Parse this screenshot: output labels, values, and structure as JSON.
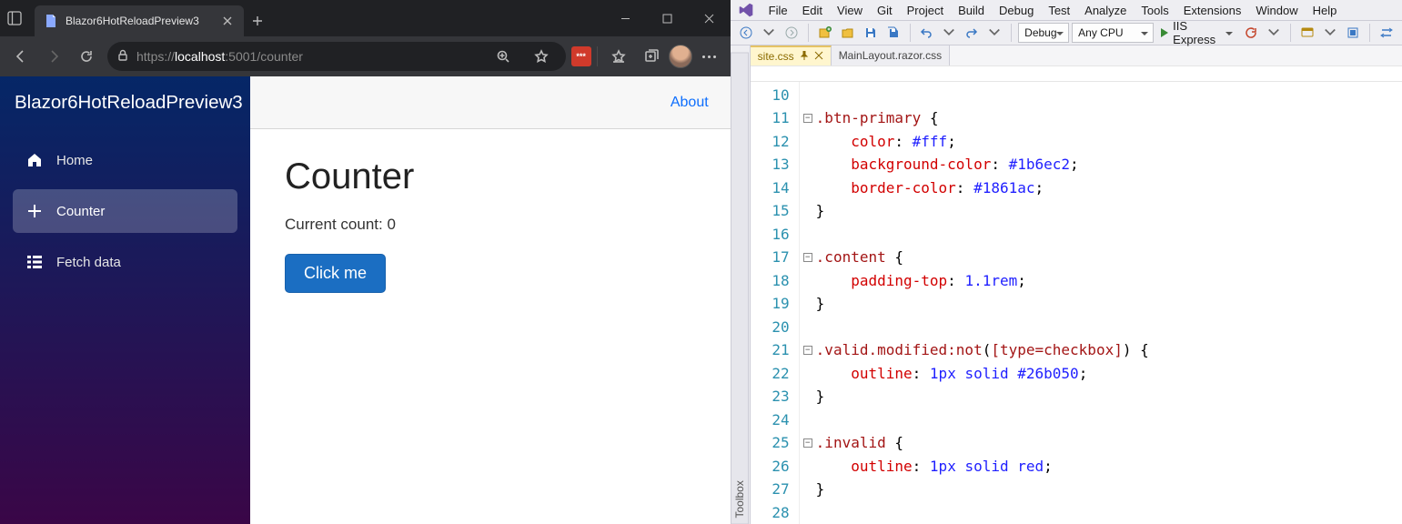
{
  "browser": {
    "tab_title": "Blazor6HotReloadPreview3",
    "url_scheme": "https://",
    "url_host": "localhost",
    "url_port_path": ":5001/counter"
  },
  "app": {
    "brand": "Blazor6HotReloadPreview3",
    "nav": {
      "home": "Home",
      "counter": "Counter",
      "fetch": "Fetch data"
    },
    "about": "About",
    "page_title": "Counter",
    "count_label": "Current count: ",
    "count_value": "0",
    "button": "Click me"
  },
  "vs": {
    "menu": [
      "File",
      "Edit",
      "View",
      "Git",
      "Project",
      "Build",
      "Debug",
      "Test",
      "Analyze",
      "Tools",
      "Extensions",
      "Window",
      "Help"
    ],
    "config": "Debug",
    "platform": "Any CPU",
    "run": "IIS Express",
    "toolbox": "Toolbox",
    "tabs": {
      "active": "site.css",
      "inactive": "MainLayout.razor.css"
    },
    "code_lines": [
      {
        "n": "10",
        "fold": "",
        "html": ""
      },
      {
        "n": "11",
        "fold": "-",
        "html": "<span class='cls'>.btn-primary</span> <span class='brace'>{</span>"
      },
      {
        "n": "12",
        "fold": "",
        "html": "    <span class='prop'>color</span><span class='punc'>:</span> <span class='val'>#fff</span><span class='punc'>;</span>"
      },
      {
        "n": "13",
        "fold": "",
        "html": "    <span class='prop'>background-color</span><span class='punc'>:</span> <span class='val'>#1b6ec2</span><span class='punc'>;</span>"
      },
      {
        "n": "14",
        "fold": "",
        "html": "    <span class='prop'>border-color</span><span class='punc'>:</span> <span class='val'>#1861ac</span><span class='punc'>;</span>"
      },
      {
        "n": "15",
        "fold": "",
        "html": "<span class='brace'>}</span>"
      },
      {
        "n": "16",
        "fold": "",
        "html": ""
      },
      {
        "n": "17",
        "fold": "-",
        "html": "<span class='cls'>.content</span> <span class='brace'>{</span>"
      },
      {
        "n": "18",
        "fold": "",
        "html": "    <span class='prop'>padding-top</span><span class='punc'>:</span> <span class='val'>1.1rem</span><span class='punc'>;</span>"
      },
      {
        "n": "19",
        "fold": "",
        "html": "<span class='brace'>}</span>"
      },
      {
        "n": "20",
        "fold": "",
        "html": ""
      },
      {
        "n": "21",
        "fold": "-",
        "html": "<span class='cls'>.valid.modified:not</span><span class='punc'>(</span><span class='cls'>[type=checkbox]</span><span class='punc'>)</span> <span class='brace'>{</span>"
      },
      {
        "n": "22",
        "fold": "",
        "html": "    <span class='prop'>outline</span><span class='punc'>:</span> <span class='val'>1px solid #26b050</span><span class='punc'>;</span>"
      },
      {
        "n": "23",
        "fold": "",
        "html": "<span class='brace'>}</span>"
      },
      {
        "n": "24",
        "fold": "",
        "html": ""
      },
      {
        "n": "25",
        "fold": "-",
        "html": "<span class='cls'>.invalid</span> <span class='brace'>{</span>"
      },
      {
        "n": "26",
        "fold": "",
        "html": "    <span class='prop'>outline</span><span class='punc'>:</span> <span class='val'>1px solid red</span><span class='punc'>;</span>"
      },
      {
        "n": "27",
        "fold": "",
        "html": "<span class='brace'>}</span>"
      },
      {
        "n": "28",
        "fold": "",
        "html": ""
      }
    ]
  }
}
